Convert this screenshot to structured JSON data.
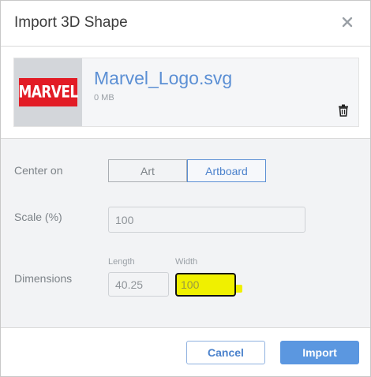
{
  "dialog": {
    "title": "Import 3D Shape",
    "close_icon": "close-icon"
  },
  "file": {
    "thumbnail_text": "MARVEL",
    "name": "Marvel_Logo.svg",
    "size": "0 MB",
    "delete_icon": "trash-icon"
  },
  "center_on": {
    "label": "Center on",
    "options": [
      "Art",
      "Artboard"
    ],
    "selected": "Artboard"
  },
  "scale": {
    "label": "Scale (%)",
    "value": "100"
  },
  "dimensions": {
    "label": "Dimensions",
    "length_label": "Length",
    "length_value": "40.25",
    "width_label": "Width",
    "width_value": "100"
  },
  "footer": {
    "cancel_label": "Cancel",
    "import_label": "Import"
  },
  "colors": {
    "accent": "#5b97e0",
    "highlight": "#f0f000",
    "logo_red": "#e21c25"
  }
}
